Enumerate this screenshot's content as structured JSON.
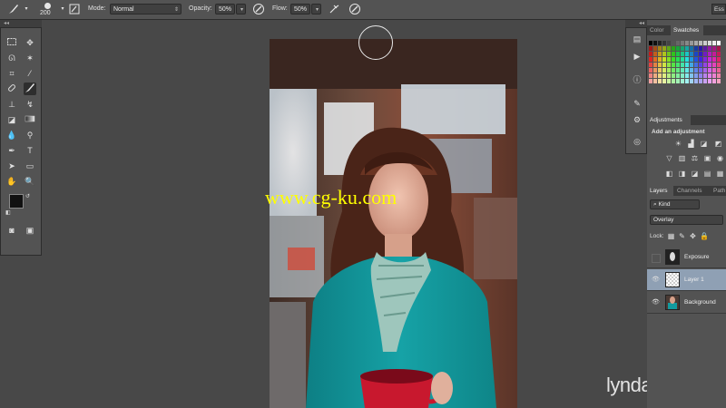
{
  "options_bar": {
    "brush_size": "200",
    "mode_label": "Mode:",
    "mode_value": "Normal",
    "opacity_label": "Opacity:",
    "opacity_value": "50%",
    "flow_label": "Flow:",
    "flow_value": "50%",
    "workspace_label": "Ess"
  },
  "icons": {
    "brush": "brush-icon",
    "airbrush": "airbrush-icon",
    "pressure_opacity": "pressure-opacity-icon",
    "pressure_size": "pressure-size-icon",
    "brush_panel": "brush-panel-icon"
  },
  "right_panels": {
    "color_tabs": [
      "Color",
      "Swatches"
    ],
    "adjustments_tab": "Adjustments",
    "adjustments_hint": "Add an adjustment",
    "layers_tabs": [
      "Layers",
      "Channels",
      "Path"
    ],
    "filter_kind": "Kind",
    "blend_mode": "Overlay",
    "lock_label": "Lock:",
    "layers": [
      {
        "name": "Exposure",
        "visible": false,
        "selected": false
      },
      {
        "name": "Layer 1",
        "visible": true,
        "selected": true
      },
      {
        "name": "Background",
        "visible": true,
        "selected": false
      }
    ]
  },
  "canvas": {
    "watermark": "www.cg-ku.com",
    "logo": "lynda.com"
  },
  "colors": {
    "foreground": "#111111",
    "background": "#ffffff",
    "ui_panel": "#535353",
    "ui_bg": "#484848",
    "selected_layer": "#8fa0b4",
    "watermark": "#ffff00"
  }
}
